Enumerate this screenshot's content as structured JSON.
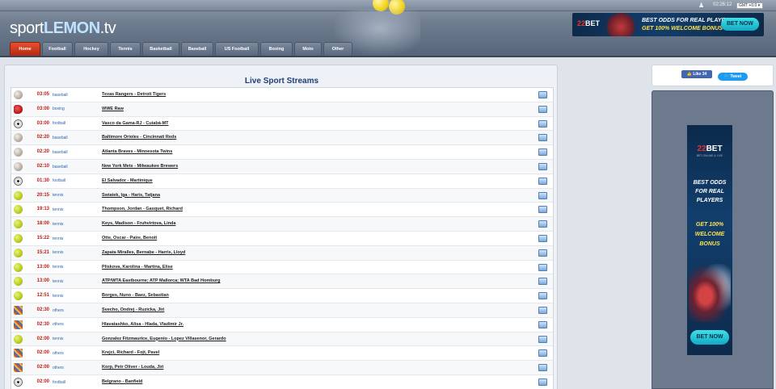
{
  "header": {
    "logo_left": "sport",
    "logo_bold": "LEMON",
    "logo_right": ".tv",
    "clock": "02:26:12",
    "timezone": "GMT +0.0 ▾"
  },
  "banner_top": {
    "logo_num": "22",
    "logo_text": "BET",
    "line1": "BEST ODDS FOR REAL PLAYERS",
    "line2": "GET 100% WELCOME BONUS",
    "button": "BET NOW"
  },
  "nav": [
    "Home",
    "Football",
    "Hockey",
    "Tennis",
    "Basketball",
    "Baseball",
    "US Football",
    "Boxing",
    "Moto",
    "Other"
  ],
  "main": {
    "title": "Live Sport Streams"
  },
  "streams": [
    {
      "icon": "baseball",
      "time": "03:05",
      "sport": "baseball",
      "event": "Texas Rangers - Detroit Tigers"
    },
    {
      "icon": "boxing",
      "time": "03:00",
      "sport": "boxing",
      "event": "WWE Raw"
    },
    {
      "icon": "football",
      "time": "03:00",
      "sport": "football",
      "event": "Vasco da Gama-RJ - Cuiabá-MT"
    },
    {
      "icon": "baseball",
      "time": "02:20",
      "sport": "baseball",
      "event": "Baltimore Orioles - Cincinnati Reds"
    },
    {
      "icon": "baseball",
      "time": "02:20",
      "sport": "baseball",
      "event": "Atlanta Braves - Minnesota Twins"
    },
    {
      "icon": "baseball",
      "time": "02:10",
      "sport": "baseball",
      "event": "New York Mets - Milwaukee Brewers"
    },
    {
      "icon": "football",
      "time": "01:30",
      "sport": "football",
      "event": "El Salvador - Martinique"
    },
    {
      "icon": "tennis",
      "time": "20:15",
      "sport": "tennis",
      "event": "Swiatek, Iga - Haris, Tatjana"
    },
    {
      "icon": "tennis",
      "time": "19:13",
      "sport": "tennis",
      "event": "Thompson, Jordan - Gasquet, Richard"
    },
    {
      "icon": "tennis",
      "time": "18:00",
      "sport": "tennis",
      "event": "Keys, Madison - Fruhvirtova, Linda"
    },
    {
      "icon": "tennis",
      "time": "15:22",
      "sport": "tennis",
      "event": "Otte, Oscar - Paire, Benoit"
    },
    {
      "icon": "tennis",
      "time": "15:21",
      "sport": "tennis",
      "event": "Zapata Miralles, Bernabe - Harris, Lloyd"
    },
    {
      "icon": "tennis",
      "time": "13:00",
      "sport": "tennis",
      "event": "Pliskova, Karolina - Martina, Elise"
    },
    {
      "icon": "tennis",
      "time": "13:00",
      "sport": "tennis",
      "event": "ATP/WTA Eastbourne; ATP Mallorca; WTA Bad Homburg"
    },
    {
      "icon": "tennis",
      "time": "12:51",
      "sport": "tennis",
      "event": "Borges, Nuno - Baez, Sebastian"
    },
    {
      "icon": "others",
      "time": "02:30",
      "sport": "others",
      "event": "Svecho, Ondrej - Ruzicka, Jiri"
    },
    {
      "icon": "others",
      "time": "02:30",
      "sport": "others",
      "event": "Hlavatashko, Alisa - Hlada, Vladimir Jr."
    },
    {
      "icon": "tennis",
      "time": "02:00",
      "sport": "tennis",
      "event": "Gonzalez Fitzmaurice, Eugenio - Lopez Villasenor, Gerardo"
    },
    {
      "icon": "others",
      "time": "02:00",
      "sport": "others",
      "event": "Krejci, Richard - Fojt, Pavel"
    },
    {
      "icon": "others",
      "time": "02:00",
      "sport": "others",
      "event": "Korp, Petr Oliver - Louda, Jiri"
    },
    {
      "icon": "football",
      "time": "02:00",
      "sport": "football",
      "event": "Belgrano - Banfield"
    }
  ],
  "social": {
    "like": "👍 Like 34",
    "tweet": "🐦 Tweet"
  },
  "banner_side": {
    "logo_num": "22",
    "logo_text": "BET",
    "tagline": "BET ONLINE & LIVE",
    "line1": "BEST ODDS FOR REAL PLAYERS",
    "line2": "GET 100% WELCOME BONUS",
    "button": "BET NOW"
  }
}
